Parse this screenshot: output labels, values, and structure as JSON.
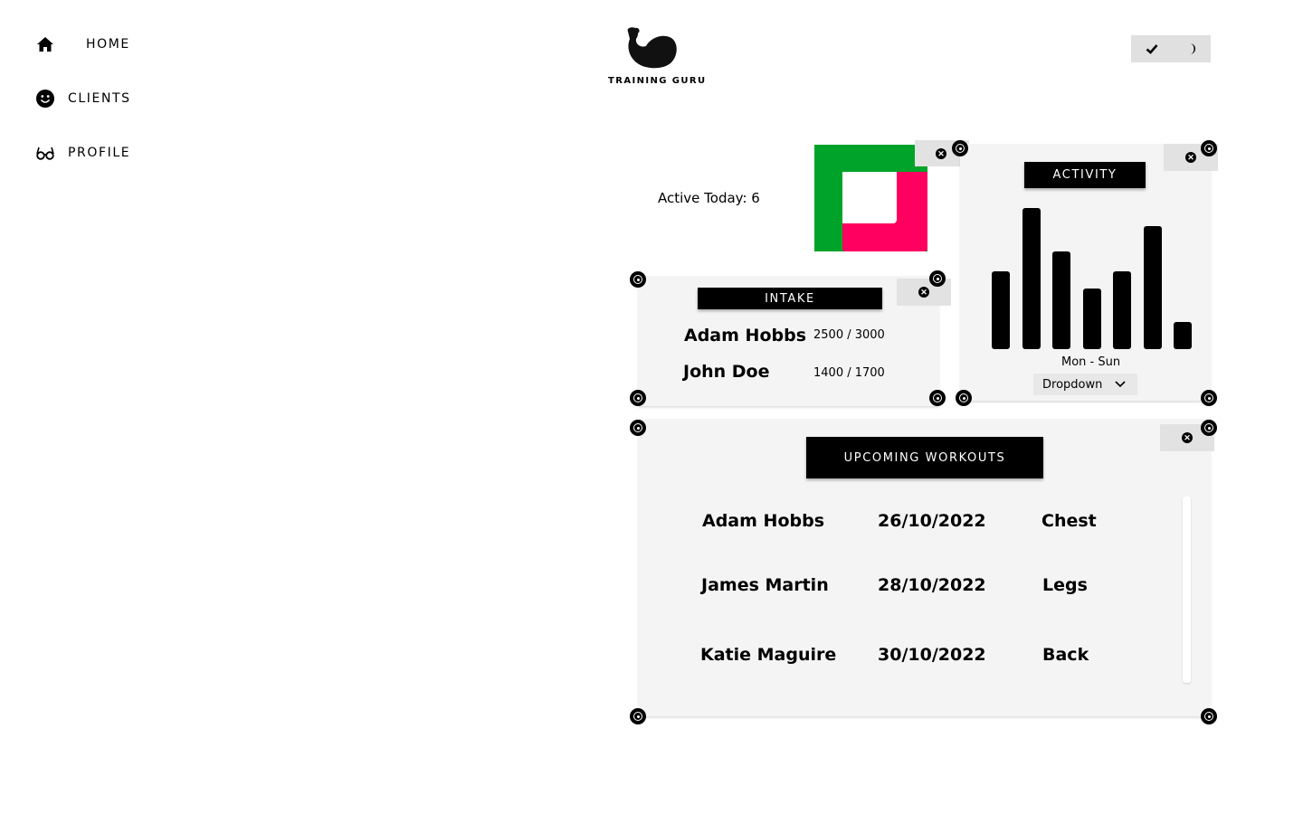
{
  "sidebar": {
    "items": [
      {
        "label": "HOME",
        "icon": "home-icon"
      },
      {
        "label": "CLIENTS",
        "icon": "smiley-icon"
      },
      {
        "label": "PROFILE",
        "icon": "glasses-icon"
      }
    ]
  },
  "brand": {
    "name": "TRAINING GURU",
    "logo": "flexed-arm-logo"
  },
  "toggle": {
    "icons": [
      "check-icon",
      "moon-icon"
    ]
  },
  "active": {
    "text": "Active Today: 6",
    "colors": {
      "outer": "#00a32a",
      "inner": "#ff0060"
    }
  },
  "intake": {
    "title": "INTAKE",
    "rows": [
      {
        "name": "Adam Hobbs",
        "value": "2500 / 3000"
      },
      {
        "name": "John Doe",
        "value": "1400 / 1700"
      }
    ]
  },
  "activity": {
    "title": "ACTIVITY",
    "xlabel": "Mon - Sun",
    "dropdown": "Dropdown",
    "bars": [
      0.55,
      1.0,
      0.69,
      0.43,
      0.55,
      0.87,
      0.19
    ]
  },
  "workouts": {
    "title": "UPCOMING WORKOUTS",
    "rows": [
      {
        "name": "Adam Hobbs",
        "date": "26/10/2022",
        "type": "Chest"
      },
      {
        "name": "James Martin",
        "date": "28/10/2022",
        "type": "Legs"
      },
      {
        "name": "Katie Maguire",
        "date": "30/10/2022",
        "type": "Back"
      }
    ]
  }
}
